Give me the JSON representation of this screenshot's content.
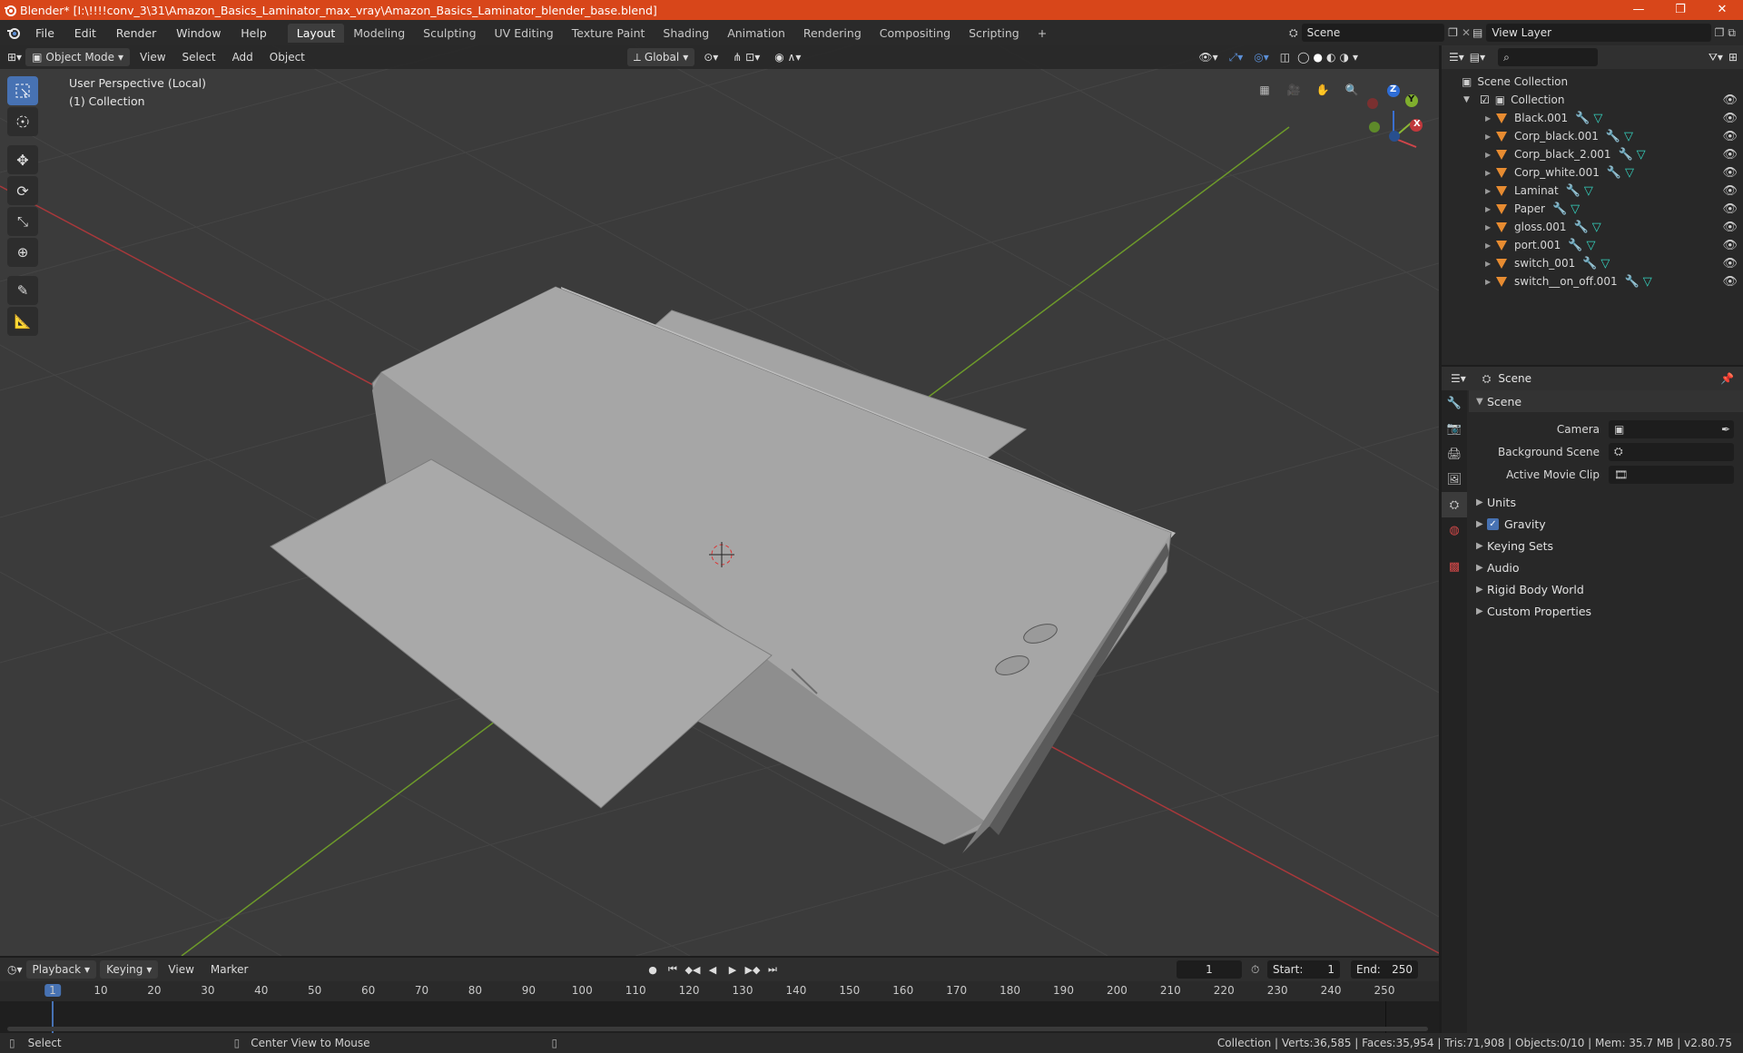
{
  "window": {
    "title": "Blender* [I:\\!!!!conv_3\\31\\Amazon_Basics_Laminator_max_vray\\Amazon_Basics_Laminator_blender_base.blend]",
    "minimize": "—",
    "maximize": "❐",
    "close": "✕"
  },
  "menu": [
    "File",
    "Edit",
    "Render",
    "Window",
    "Help"
  ],
  "workspaces": [
    "Layout",
    "Modeling",
    "Sculpting",
    "UV Editing",
    "Texture Paint",
    "Shading",
    "Animation",
    "Rendering",
    "Compositing",
    "Scripting"
  ],
  "active_workspace": "Layout",
  "add_tab": "+",
  "scene_name": "Scene",
  "view_layer": "View Layer",
  "viewport": {
    "mode": "Object Mode",
    "menus": [
      "View",
      "Select",
      "Add",
      "Object"
    ],
    "orientation": "Global",
    "info_line1": "User Perspective (Local)",
    "info_line2": "(1) Collection",
    "gizmo_axes": [
      "Z",
      "Y",
      "X"
    ],
    "colors": {
      "x_axis": "#c0383c",
      "y_axis": "#7fae2d",
      "z_axis": "#2e6dd6",
      "bg": "#3b3b3b"
    }
  },
  "outliner": {
    "root": "Scene Collection",
    "collection": "Collection",
    "objects": [
      "Black.001",
      "Corp_black.001",
      "Corp_black_2.001",
      "Corp_white.001",
      "Laminat",
      "Paper",
      "gloss.001",
      "port.001",
      "switch_001",
      "switch__on_off.001"
    ]
  },
  "properties": {
    "header": "Scene",
    "panel": "Scene",
    "camera_label": "Camera",
    "background_label": "Background Scene",
    "movieclip_label": "Active Movie Clip",
    "sections": [
      "Units",
      "Gravity",
      "Keying Sets",
      "Audio",
      "Rigid Body World",
      "Custom Properties"
    ],
    "gravity_checked": true
  },
  "timeline": {
    "menus": [
      "Playback",
      "Keying",
      "View",
      "Marker"
    ],
    "current_frame": "1",
    "start_label": "Start:",
    "start": "1",
    "end_label": "End:",
    "end": "250",
    "ticks": [
      "1",
      "10",
      "20",
      "30",
      "40",
      "50",
      "60",
      "70",
      "80",
      "90",
      "100",
      "110",
      "120",
      "130",
      "140",
      "150",
      "160",
      "170",
      "180",
      "190",
      "200",
      "210",
      "220",
      "230",
      "240",
      "250"
    ]
  },
  "status": {
    "left": "Select",
    "middle": "Center View to Mouse",
    "right": "Collection | Verts:36,585 | Faces:35,954 | Tris:71,908 | Objects:0/10 | Mem: 35.7 MB | v2.80.75"
  }
}
